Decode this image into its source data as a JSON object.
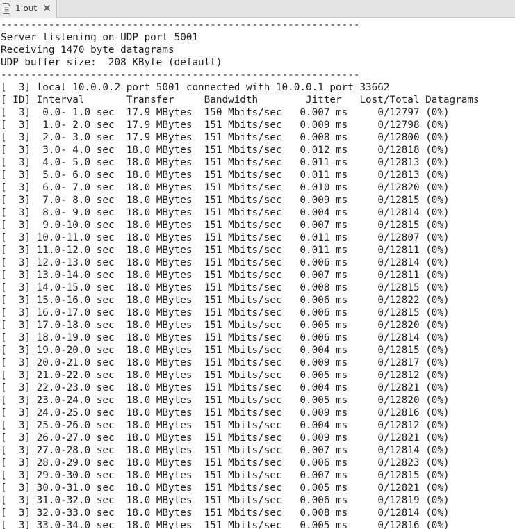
{
  "tab": {
    "label": "1.out",
    "icon": "document-icon",
    "close_icon": "close-icon"
  },
  "content": {
    "header_lines": [
      "------------------------------------------------------------",
      "Server listening on UDP port 5001",
      "Receiving 1470 byte datagrams",
      "UDP buffer size:  208 KByte (default)",
      "------------------------------------------------------------",
      "[  3] local 10.0.0.2 port 5001 connected with 10.0.0.1 port 33662",
      "[ ID] Interval       Transfer     Bandwidth        Jitter   Lost/Total Datagrams"
    ],
    "report_columns": [
      "ID",
      "Interval",
      "Transfer",
      "Bandwidth",
      "Jitter",
      "Lost/Total Datagrams"
    ],
    "report_rows": [
      {
        "id": "3",
        "interval": "0.0- 1.0 sec",
        "transfer": "17.9 MBytes",
        "bandwidth": "150 Mbits/sec",
        "jitter": "0.007 ms",
        "lost_total": "0/12797",
        "loss_pct": "(0%)"
      },
      {
        "id": "3",
        "interval": "1.0- 2.0 sec",
        "transfer": "17.9 MBytes",
        "bandwidth": "151 Mbits/sec",
        "jitter": "0.009 ms",
        "lost_total": "0/12798",
        "loss_pct": "(0%)"
      },
      {
        "id": "3",
        "interval": "2.0- 3.0 sec",
        "transfer": "17.9 MBytes",
        "bandwidth": "151 Mbits/sec",
        "jitter": "0.008 ms",
        "lost_total": "0/12800",
        "loss_pct": "(0%)"
      },
      {
        "id": "3",
        "interval": "3.0- 4.0 sec",
        "transfer": "18.0 MBytes",
        "bandwidth": "151 Mbits/sec",
        "jitter": "0.012 ms",
        "lost_total": "0/12818",
        "loss_pct": "(0%)"
      },
      {
        "id": "3",
        "interval": "4.0- 5.0 sec",
        "transfer": "18.0 MBytes",
        "bandwidth": "151 Mbits/sec",
        "jitter": "0.011 ms",
        "lost_total": "0/12813",
        "loss_pct": "(0%)"
      },
      {
        "id": "3",
        "interval": "5.0- 6.0 sec",
        "transfer": "18.0 MBytes",
        "bandwidth": "151 Mbits/sec",
        "jitter": "0.011 ms",
        "lost_total": "0/12813",
        "loss_pct": "(0%)"
      },
      {
        "id": "3",
        "interval": "6.0- 7.0 sec",
        "transfer": "18.0 MBytes",
        "bandwidth": "151 Mbits/sec",
        "jitter": "0.010 ms",
        "lost_total": "0/12820",
        "loss_pct": "(0%)"
      },
      {
        "id": "3",
        "interval": "7.0- 8.0 sec",
        "transfer": "18.0 MBytes",
        "bandwidth": "151 Mbits/sec",
        "jitter": "0.009 ms",
        "lost_total": "0/12815",
        "loss_pct": "(0%)"
      },
      {
        "id": "3",
        "interval": "8.0- 9.0 sec",
        "transfer": "18.0 MBytes",
        "bandwidth": "151 Mbits/sec",
        "jitter": "0.004 ms",
        "lost_total": "0/12814",
        "loss_pct": "(0%)"
      },
      {
        "id": "3",
        "interval": "9.0-10.0 sec",
        "transfer": "18.0 MBytes",
        "bandwidth": "151 Mbits/sec",
        "jitter": "0.007 ms",
        "lost_total": "0/12815",
        "loss_pct": "(0%)"
      },
      {
        "id": "3",
        "interval": "10.0-11.0 sec",
        "transfer": "18.0 MBytes",
        "bandwidth": "151 Mbits/sec",
        "jitter": "0.011 ms",
        "lost_total": "0/12807",
        "loss_pct": "(0%)"
      },
      {
        "id": "3",
        "interval": "11.0-12.0 sec",
        "transfer": "18.0 MBytes",
        "bandwidth": "151 Mbits/sec",
        "jitter": "0.011 ms",
        "lost_total": "0/12811",
        "loss_pct": "(0%)"
      },
      {
        "id": "3",
        "interval": "12.0-13.0 sec",
        "transfer": "18.0 MBytes",
        "bandwidth": "151 Mbits/sec",
        "jitter": "0.006 ms",
        "lost_total": "0/12814",
        "loss_pct": "(0%)"
      },
      {
        "id": "3",
        "interval": "13.0-14.0 sec",
        "transfer": "18.0 MBytes",
        "bandwidth": "151 Mbits/sec",
        "jitter": "0.007 ms",
        "lost_total": "0/12811",
        "loss_pct": "(0%)"
      },
      {
        "id": "3",
        "interval": "14.0-15.0 sec",
        "transfer": "18.0 MBytes",
        "bandwidth": "151 Mbits/sec",
        "jitter": "0.008 ms",
        "lost_total": "0/12815",
        "loss_pct": "(0%)"
      },
      {
        "id": "3",
        "interval": "15.0-16.0 sec",
        "transfer": "18.0 MBytes",
        "bandwidth": "151 Mbits/sec",
        "jitter": "0.006 ms",
        "lost_total": "0/12822",
        "loss_pct": "(0%)"
      },
      {
        "id": "3",
        "interval": "16.0-17.0 sec",
        "transfer": "18.0 MBytes",
        "bandwidth": "151 Mbits/sec",
        "jitter": "0.006 ms",
        "lost_total": "0/12815",
        "loss_pct": "(0%)"
      },
      {
        "id": "3",
        "interval": "17.0-18.0 sec",
        "transfer": "18.0 MBytes",
        "bandwidth": "151 Mbits/sec",
        "jitter": "0.005 ms",
        "lost_total": "0/12820",
        "loss_pct": "(0%)"
      },
      {
        "id": "3",
        "interval": "18.0-19.0 sec",
        "transfer": "18.0 MBytes",
        "bandwidth": "151 Mbits/sec",
        "jitter": "0.006 ms",
        "lost_total": "0/12814",
        "loss_pct": "(0%)"
      },
      {
        "id": "3",
        "interval": "19.0-20.0 sec",
        "transfer": "18.0 MBytes",
        "bandwidth": "151 Mbits/sec",
        "jitter": "0.004 ms",
        "lost_total": "0/12815",
        "loss_pct": "(0%)"
      },
      {
        "id": "3",
        "interval": "20.0-21.0 sec",
        "transfer": "18.0 MBytes",
        "bandwidth": "151 Mbits/sec",
        "jitter": "0.009 ms",
        "lost_total": "0/12817",
        "loss_pct": "(0%)"
      },
      {
        "id": "3",
        "interval": "21.0-22.0 sec",
        "transfer": "18.0 MBytes",
        "bandwidth": "151 Mbits/sec",
        "jitter": "0.005 ms",
        "lost_total": "0/12812",
        "loss_pct": "(0%)"
      },
      {
        "id": "3",
        "interval": "22.0-23.0 sec",
        "transfer": "18.0 MBytes",
        "bandwidth": "151 Mbits/sec",
        "jitter": "0.004 ms",
        "lost_total": "0/12821",
        "loss_pct": "(0%)"
      },
      {
        "id": "3",
        "interval": "23.0-24.0 sec",
        "transfer": "18.0 MBytes",
        "bandwidth": "151 Mbits/sec",
        "jitter": "0.005 ms",
        "lost_total": "0/12820",
        "loss_pct": "(0%)"
      },
      {
        "id": "3",
        "interval": "24.0-25.0 sec",
        "transfer": "18.0 MBytes",
        "bandwidth": "151 Mbits/sec",
        "jitter": "0.009 ms",
        "lost_total": "0/12816",
        "loss_pct": "(0%)"
      },
      {
        "id": "3",
        "interval": "25.0-26.0 sec",
        "transfer": "18.0 MBytes",
        "bandwidth": "151 Mbits/sec",
        "jitter": "0.004 ms",
        "lost_total": "0/12812",
        "loss_pct": "(0%)"
      },
      {
        "id": "3",
        "interval": "26.0-27.0 sec",
        "transfer": "18.0 MBytes",
        "bandwidth": "151 Mbits/sec",
        "jitter": "0.009 ms",
        "lost_total": "0/12821",
        "loss_pct": "(0%)"
      },
      {
        "id": "3",
        "interval": "27.0-28.0 sec",
        "transfer": "18.0 MBytes",
        "bandwidth": "151 Mbits/sec",
        "jitter": "0.007 ms",
        "lost_total": "0/12814",
        "loss_pct": "(0%)"
      },
      {
        "id": "3",
        "interval": "28.0-29.0 sec",
        "transfer": "18.0 MBytes",
        "bandwidth": "151 Mbits/sec",
        "jitter": "0.006 ms",
        "lost_total": "0/12823",
        "loss_pct": "(0%)"
      },
      {
        "id": "3",
        "interval": "29.0-30.0 sec",
        "transfer": "18.0 MBytes",
        "bandwidth": "151 Mbits/sec",
        "jitter": "0.007 ms",
        "lost_total": "0/12815",
        "loss_pct": "(0%)"
      },
      {
        "id": "3",
        "interval": "30.0-31.0 sec",
        "transfer": "18.0 MBytes",
        "bandwidth": "151 Mbits/sec",
        "jitter": "0.005 ms",
        "lost_total": "0/12821",
        "loss_pct": "(0%)"
      },
      {
        "id": "3",
        "interval": "31.0-32.0 sec",
        "transfer": "18.0 MBytes",
        "bandwidth": "151 Mbits/sec",
        "jitter": "0.006 ms",
        "lost_total": "0/12819",
        "loss_pct": "(0%)"
      },
      {
        "id": "3",
        "interval": "32.0-33.0 sec",
        "transfer": "18.0 MBytes",
        "bandwidth": "151 Mbits/sec",
        "jitter": "0.008 ms",
        "lost_total": "0/12814",
        "loss_pct": "(0%)"
      },
      {
        "id": "3",
        "interval": "33.0-34.0 sec",
        "transfer": "18.0 MBytes",
        "bandwidth": "151 Mbits/sec",
        "jitter": "0.005 ms",
        "lost_total": "0/12816",
        "loss_pct": "(0%)"
      }
    ]
  }
}
